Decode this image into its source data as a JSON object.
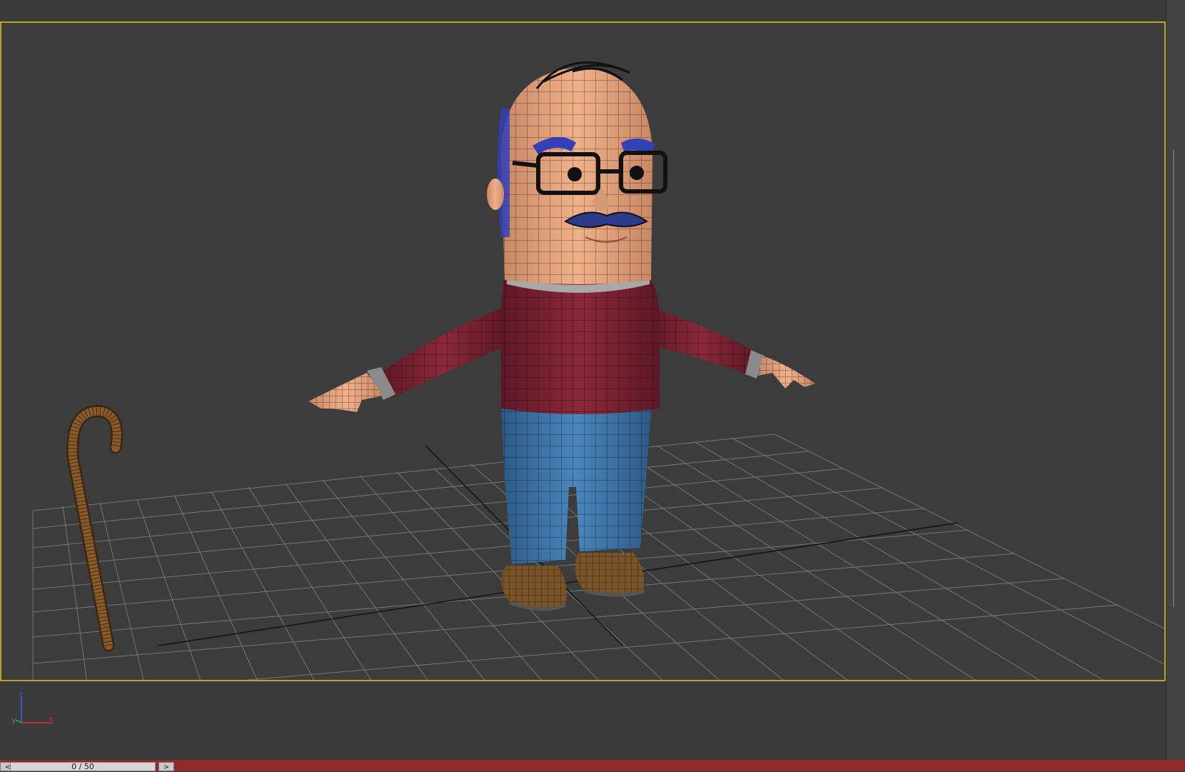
{
  "viewport": {
    "axis_tripod": {
      "z_label": "z",
      "x_label": "x",
      "y_label": "y"
    }
  },
  "timeline": {
    "slider_text": "0 / 50",
    "prev_label": "<",
    "next_label": ">"
  },
  "colors": {
    "viewport_border": "#b8a42a",
    "time_bar": "#8f2a2a",
    "skin": "#e6a27c",
    "sweater": "#7b2232",
    "jeans": "#3d74a8",
    "shoes": "#7a5428",
    "eyebrows": "#3340b8",
    "cane": "#7a5025"
  }
}
